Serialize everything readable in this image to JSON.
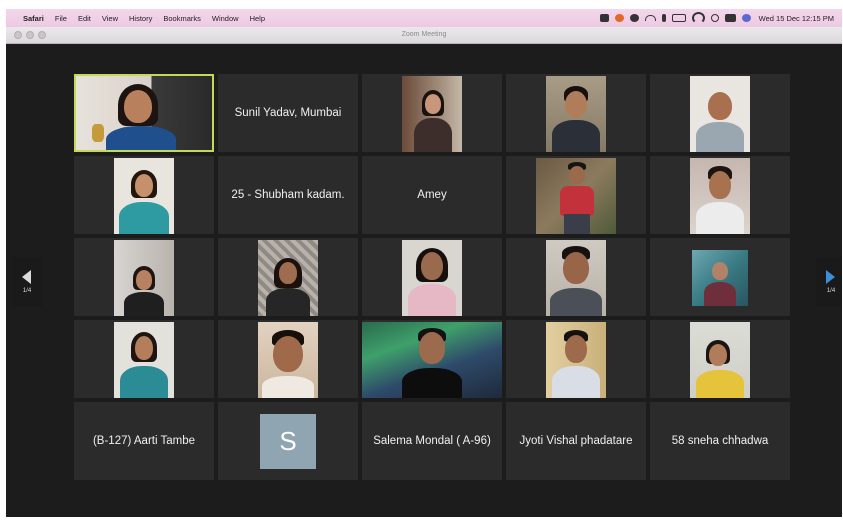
{
  "menubar": {
    "app": "Safari",
    "items": [
      "File",
      "Edit",
      "View",
      "History",
      "Bookmarks",
      "Window",
      "Help"
    ],
    "clock": "Wed 15 Dec  12:15 PM"
  },
  "window": {
    "title": "Zoom Meeting"
  },
  "gallery": {
    "page_indicator_left": "1/4",
    "page_indicator_right": "1/4",
    "name_tiles": {
      "sunil": "Sunil Yadav, Mumbai",
      "shubham": "25 - Shubham kadam.",
      "amey": "Amey",
      "aarti": "(B-127) Aarti Tambe",
      "salema": "Salema Mondal ( A-96)",
      "jyoti": "Jyoti Vishal phadatare",
      "sneha": "58 sneha chhadwa"
    },
    "avatar_letter": "S"
  },
  "colors": {
    "active_speaker_border": "#c5d957",
    "tile_background": "#2b2b2b",
    "stage_background": "#1c1c1c",
    "avatar_background": "#8fa6b2",
    "pager_arrow": "#3c8fd6"
  }
}
